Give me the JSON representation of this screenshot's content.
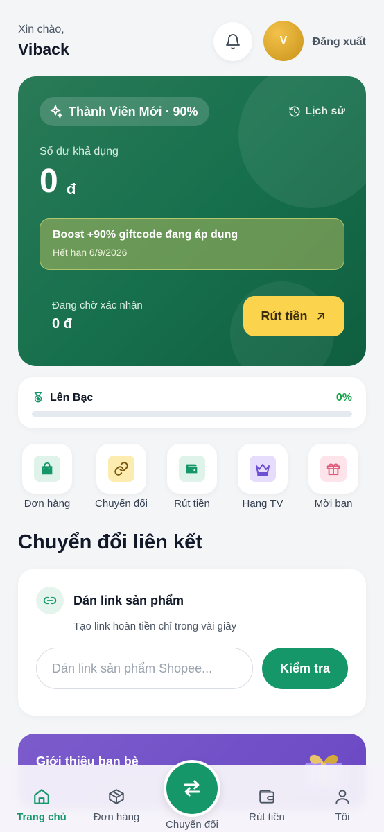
{
  "header": {
    "greeting": "Xin chào,",
    "username": "Viback",
    "avatar_initial": "V",
    "logout_label": "Đăng xuất"
  },
  "balance_card": {
    "tier_label": "Thành Viên Mới · 90%",
    "history_label": "Lịch sử",
    "available_label": "Số dư khả dụng",
    "available_amount": "0",
    "currency": "đ",
    "boost_title": "Boost +90% giftcode đang áp dụng",
    "boost_expiry": "Hết hạn 6/9/2026",
    "pending_label": "Đang chờ xác nhận",
    "pending_amount": "0 đ",
    "withdraw_label": "Rút tiền"
  },
  "level": {
    "name": "Lên Bạc",
    "percent_text": "0%",
    "progress": 0
  },
  "quick_actions": [
    {
      "label": "Đơn hàng",
      "icon": "shopping-bag-icon",
      "color": "#16976a",
      "bg": "#dff3ea"
    },
    {
      "label": "Chuyển đổi",
      "icon": "link-icon",
      "color": "#7a5a12",
      "bg": "#fdecb0"
    },
    {
      "label": "Rút tiền",
      "icon": "wallet-icon",
      "color": "#16976a",
      "bg": "#dff3ea"
    },
    {
      "label": "Hạng TV",
      "icon": "crown-icon",
      "color": "#6d4fd1",
      "bg": "#e5ddfb"
    },
    {
      "label": "Mời bạn",
      "icon": "gift-icon",
      "color": "#e25a7a",
      "bg": "#fde3ea"
    }
  ],
  "section_title": "Chuyển đổi liên kết",
  "convert": {
    "title": "Dán link sản phẩm",
    "subtitle": "Tạo link hoàn tiền chỉ trong vài giây",
    "input_placeholder": "Dán link sản phẩm Shopee...",
    "input_value": "",
    "check_label": "Kiểm tra"
  },
  "promo": {
    "title": "Giới thiệu bạn bè"
  },
  "tabbar": {
    "home": "Trang chủ",
    "orders": "Đơn hàng",
    "convert": "Chuyển đổi",
    "withdraw": "Rút tiền",
    "me": "Tôi",
    "active_color": "#16976a"
  }
}
